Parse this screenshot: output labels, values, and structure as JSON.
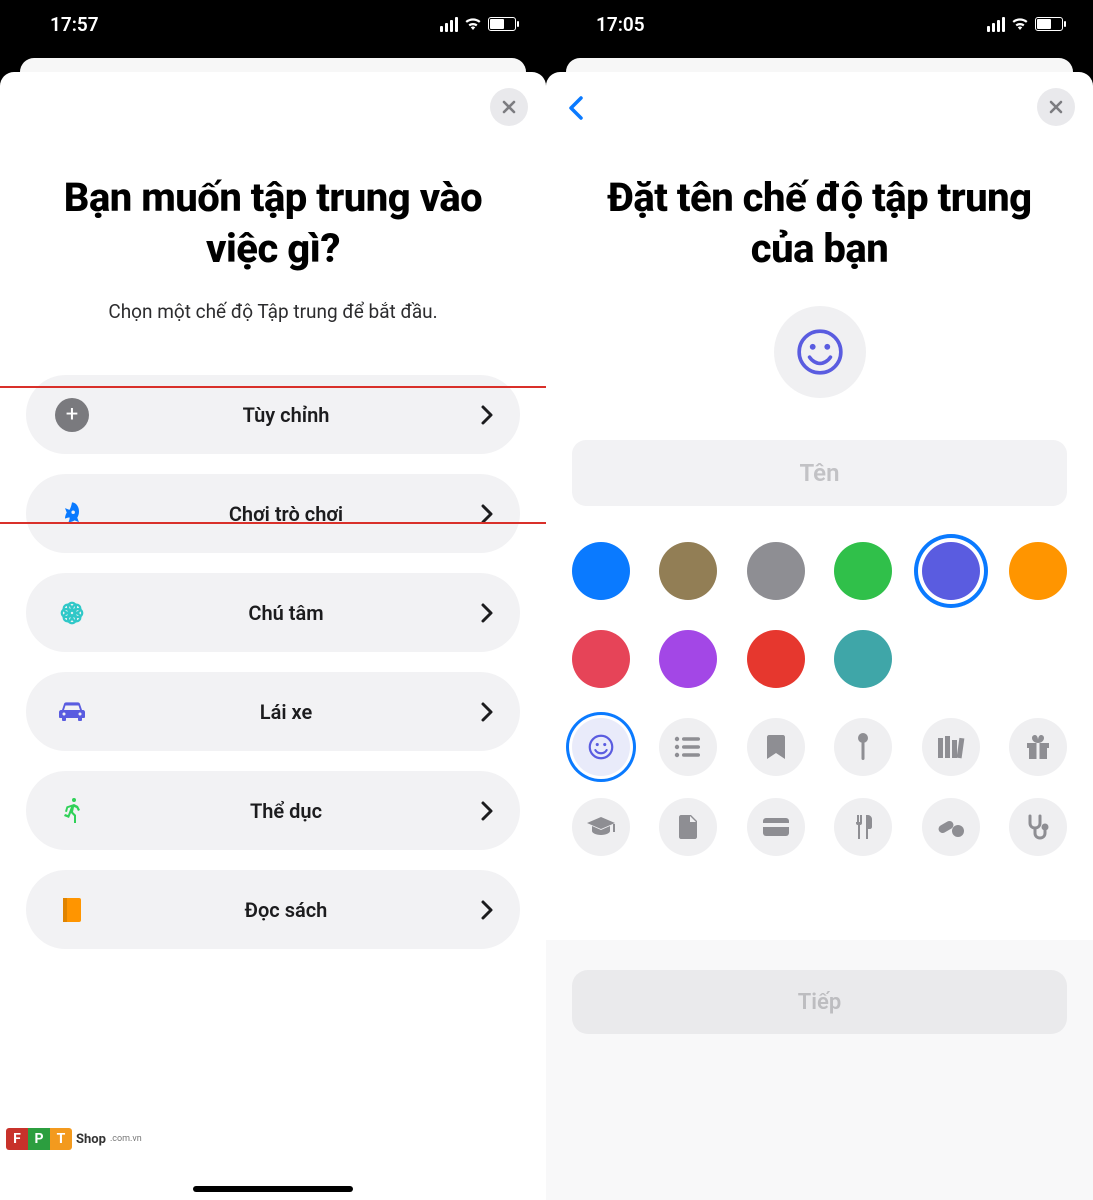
{
  "left": {
    "status_time": "17:57",
    "title": "Bạn muốn tập trung vào việc gì?",
    "subtitle": "Chọn một chế độ Tập trung để bắt đầu.",
    "rows": [
      {
        "label": "Tùy chỉnh",
        "icon": "plus",
        "color": "#7a7a7e",
        "highlighted": true
      },
      {
        "label": "Chơi trò chơi",
        "icon": "rocket",
        "color": "#0a7aff"
      },
      {
        "label": "Chú tâm",
        "icon": "flower",
        "color": "#30c8c8"
      },
      {
        "label": "Lái xe",
        "icon": "car",
        "color": "#5a5ce0"
      },
      {
        "label": "Thể dục",
        "icon": "running",
        "color": "#30d158"
      },
      {
        "label": "Đọc sách",
        "icon": "book",
        "color": "#ff9500"
      }
    ]
  },
  "right": {
    "status_time": "17:05",
    "title": "Đặt tên chế độ tập trung của bạn",
    "name_placeholder": "Tên",
    "colors": [
      "#0a7aff",
      "#927e55",
      "#8e8e93",
      "#30c04a",
      "#5a5ce0",
      "#ff9500",
      "#e64458",
      "#a347e6",
      "#e6372e",
      "#3fa6a8"
    ],
    "selected_color_index": 4,
    "icons": [
      "smile",
      "list",
      "bookmark",
      "pin",
      "books",
      "gift",
      "grad",
      "doc",
      "card",
      "utensils",
      "pills",
      "steth"
    ],
    "selected_icon_index": 0,
    "next_label": "Tiếp"
  },
  "watermark": {
    "brand": "FPT",
    "text": "Shop",
    "sub": ".com.vn"
  }
}
